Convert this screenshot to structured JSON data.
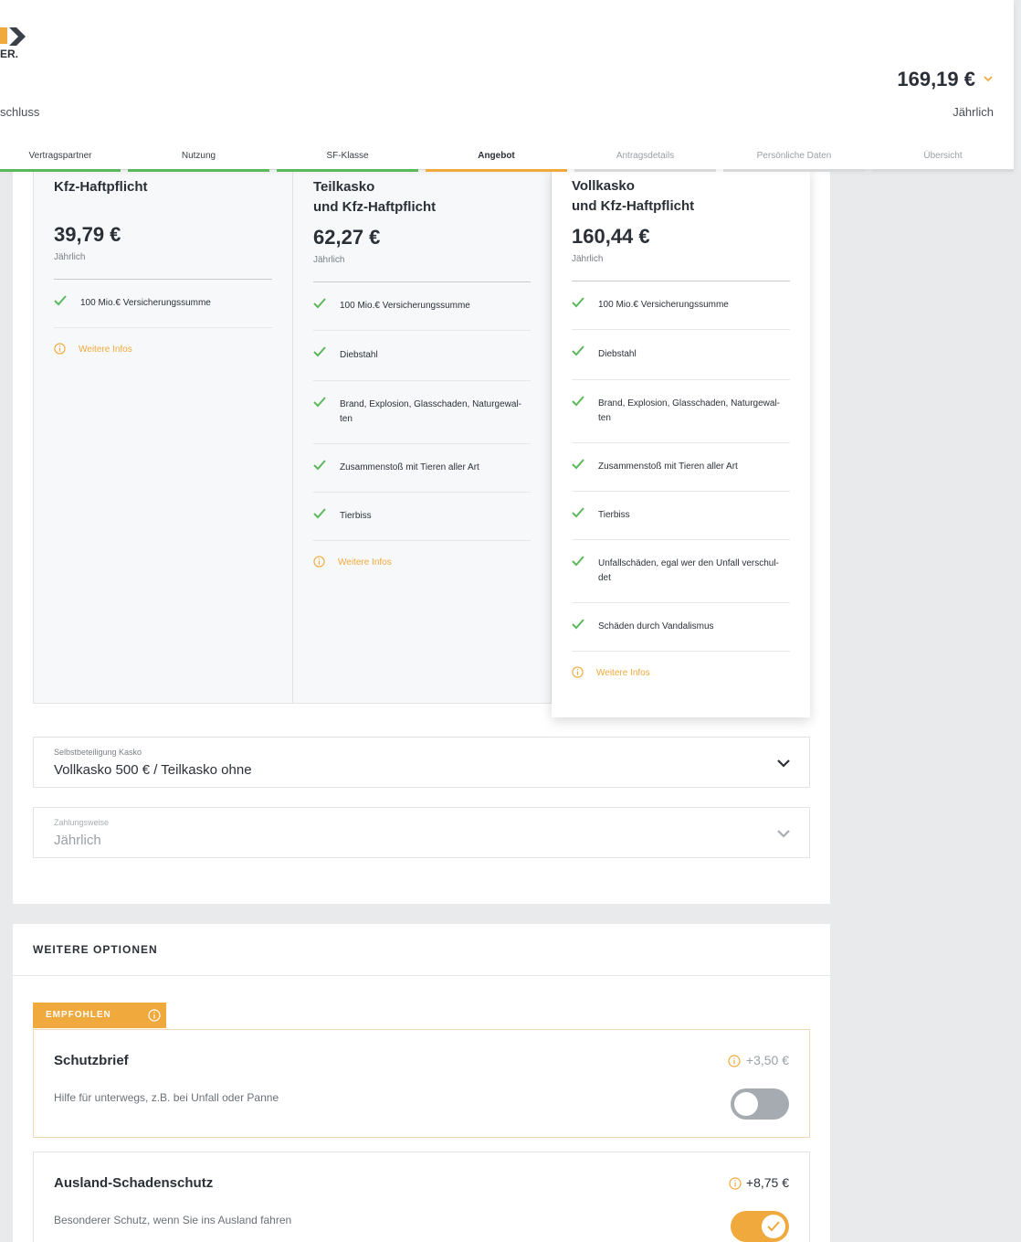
{
  "header": {
    "logo_text": "ER.",
    "breadcrumb_cut": "schluss",
    "total_price": "169,19 €",
    "total_period": "Jährlich",
    "steps": [
      {
        "label": "Vertragspartner",
        "state": "done"
      },
      {
        "label": "Nutzung",
        "state": "done"
      },
      {
        "label": "SF-Klasse",
        "state": "done"
      },
      {
        "label": "Angebot",
        "state": "current"
      },
      {
        "label": "Antragsdetails",
        "state": "todo"
      },
      {
        "label": "Persönliche Daten",
        "state": "todo"
      },
      {
        "label": "Übersicht",
        "state": "todo"
      }
    ]
  },
  "tariffs": [
    {
      "name_line1": "Kfz-Haftpflicht",
      "name_line2": "",
      "price": "39,79 €",
      "period": "Jährlich",
      "features": [
        "100 Mio.€ Versicherungssumme"
      ],
      "more": "Weitere Infos"
    },
    {
      "name_line1": "Teilkasko",
      "name_line2": "und Kfz-Haftpflicht",
      "price": "62,27 €",
      "period": "Jährlich",
      "features": [
        "100 Mio.€ Versicherungssumme",
        "Diebstahl",
        "Brand, Explosion, Glasschaden, Naturgewal-ten",
        "Zusammenstoß mit Tieren aller Art",
        "Tierbiss"
      ],
      "more": "Weitere Infos"
    },
    {
      "name_line1": "Vollkasko",
      "name_line2": "und Kfz-Haftpflicht",
      "price": "160,44 €",
      "period": "Jährlich",
      "features": [
        "100 Mio.€ Versicherungssumme",
        "Diebstahl",
        "Brand, Explosion, Glasschaden, Naturgewal-ten",
        "Zusammenstoß mit Tieren aller Art",
        "Tierbiss",
        "Unfallschäden, egal wer den Unfall verschul-det",
        "Schäden durch Vandalismus"
      ],
      "more": "Weitere Infos"
    }
  ],
  "deductible": {
    "label": "Selbstbeteiligung Kasko",
    "value": "Vollkasko 500 € / Teilkasko ohne"
  },
  "payment": {
    "label": "Zahlungsweise",
    "value": "Jährlich"
  },
  "options": {
    "title": "WEITERE OPTIONEN",
    "badge": "EMPFOHLEN",
    "items": [
      {
        "name": "Schutzbrief",
        "desc": "Hilfe für unterwegs, z.B. bei Unfall oder Panne",
        "price": "+3,50 €",
        "enabled": false
      },
      {
        "name": "Ausland-Schadenschutz",
        "desc": "Besonderer Schutz, wenn Sie ins Ausland fahren",
        "price": "+8,75 €",
        "enabled": true
      }
    ]
  },
  "colors": {
    "accent": "#f0a93c",
    "success": "#5cb85c",
    "text": "#2b3038"
  }
}
